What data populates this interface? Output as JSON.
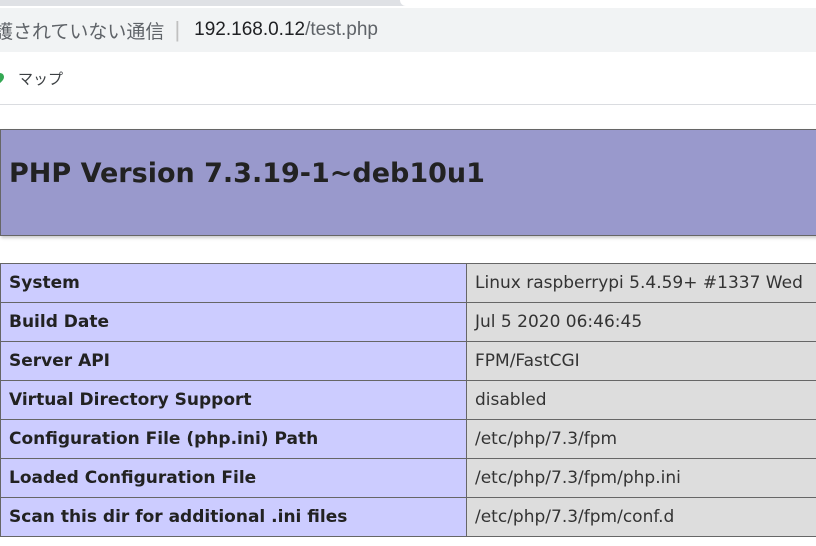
{
  "browser": {
    "security_label": "護されていない通信",
    "url_host": "192.168.0.12",
    "url_path": "/test.php",
    "bookmarks": [
      {
        "label": "マップ",
        "icon": "map-pin-icon"
      }
    ]
  },
  "php_info": {
    "title": "PHP Version 7.3.19-1~deb10u1",
    "rows": [
      {
        "key": "System",
        "value": "Linux raspberrypi 5.4.59+ #1337 Wed"
      },
      {
        "key": "Build Date",
        "value": "Jul 5 2020 06:46:45"
      },
      {
        "key": "Server API",
        "value": "FPM/FastCGI"
      },
      {
        "key": "Virtual Directory Support",
        "value": "disabled"
      },
      {
        "key": "Configuration File (php.ini) Path",
        "value": "/etc/php/7.3/fpm"
      },
      {
        "key": "Loaded Configuration File",
        "value": "/etc/php/7.3/fpm/php.ini"
      },
      {
        "key": "Scan this dir for additional .ini files",
        "value": "/etc/php/7.3/fpm/conf.d"
      }
    ]
  },
  "colors": {
    "header_bg": "#9999cc",
    "key_cell_bg": "#ccccff",
    "value_cell_bg": "#dddddd"
  }
}
